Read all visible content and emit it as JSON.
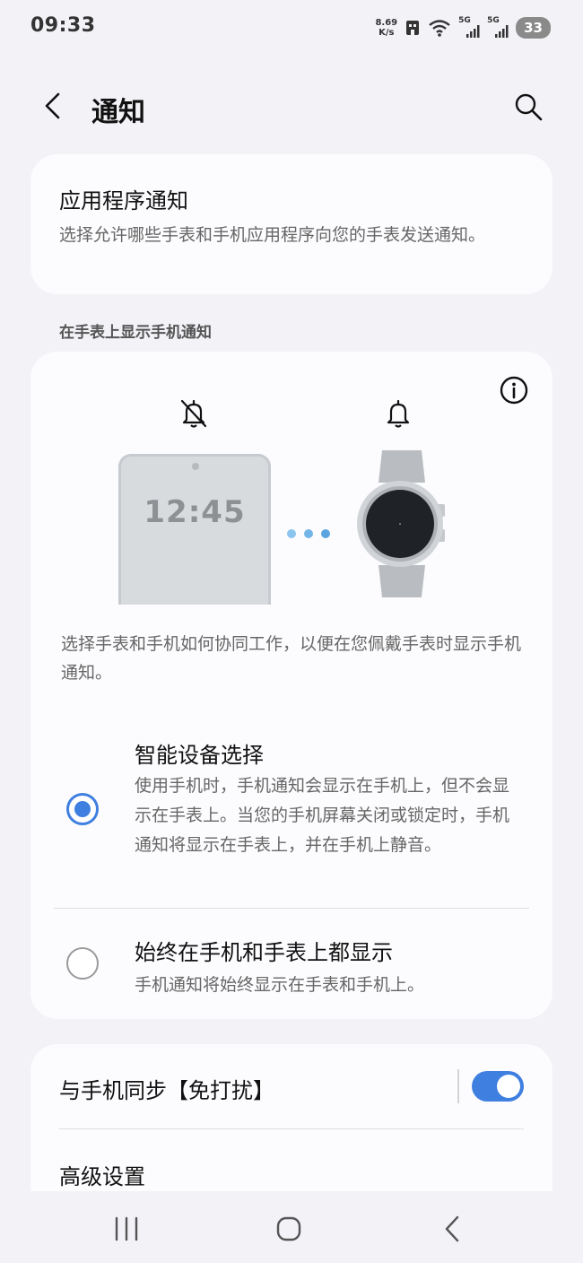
{
  "status_bar": {
    "time": "09:33",
    "net_speed_value": "8.69",
    "net_speed_unit": "K/s",
    "signal1_label": "5G",
    "signal2_label": "5G",
    "battery": "33"
  },
  "header": {
    "title": "通知",
    "back_icon": "chevron-left-icon",
    "search_icon": "search-icon"
  },
  "app_notifications": {
    "title": "应用程序通知",
    "description": "选择允许哪些手表和手机应用程序向您的手表发送通知。"
  },
  "section_label": "在手表上显示手机通知",
  "illustration": {
    "phone_time": "12:45",
    "left_icon": "bell-off-icon",
    "right_icon": "bell-icon",
    "description": "选择手表和手机如何协同工作，以便在您佩戴手表时显示手机通知。"
  },
  "options": [
    {
      "title": "智能设备选择",
      "description": "使用手机时，手机通知会显示在手机上，但不会显示在手表上。当您的手机屏幕关闭或锁定时，手机通知将显示在手表上，并在手机上静音。",
      "selected": true
    },
    {
      "title": "始终在手机和手表上都显示",
      "description": "手机通知将始终显示在手表和手机上。",
      "selected": false
    }
  ],
  "settings": {
    "sync_dnd_label": "与手机同步【免打扰】",
    "sync_dnd_enabled": true,
    "advanced_label": "高级设置"
  },
  "colors": {
    "accent": "#3f7fe0",
    "background": "#f2f2f7",
    "card": "#fcfcfe"
  }
}
